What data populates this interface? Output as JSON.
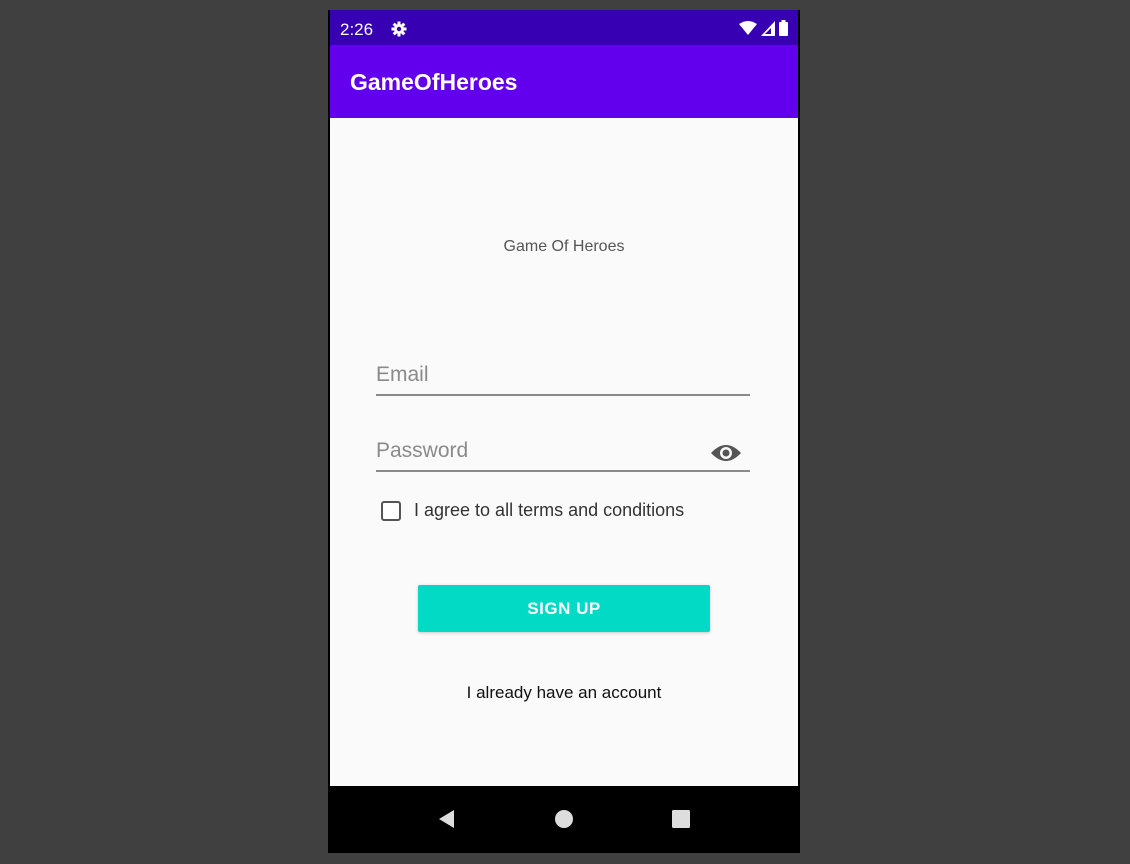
{
  "status_bar": {
    "time": "2:26",
    "icons": [
      "settings-icon",
      "wifi-icon",
      "signal-icon",
      "battery-icon"
    ]
  },
  "app_bar": {
    "title": "GameOfHeroes"
  },
  "main": {
    "hero_text": "Game Of Heroes",
    "email": {
      "placeholder": "Email",
      "value": ""
    },
    "password": {
      "placeholder": "Password",
      "value": ""
    },
    "terms_checkbox": {
      "label": "I agree to all terms and conditions",
      "checked": false
    },
    "signup_button": {
      "label": "SIGN UP"
    },
    "login_link": {
      "label": "I already have an account"
    }
  },
  "nav_bar": {
    "buttons": [
      "back-icon",
      "home-icon",
      "recents-icon"
    ]
  },
  "colors": {
    "status_bar": "#3700b3",
    "app_bar": "#6200ee",
    "accent": "#03dac5",
    "background": "#fafafa"
  }
}
